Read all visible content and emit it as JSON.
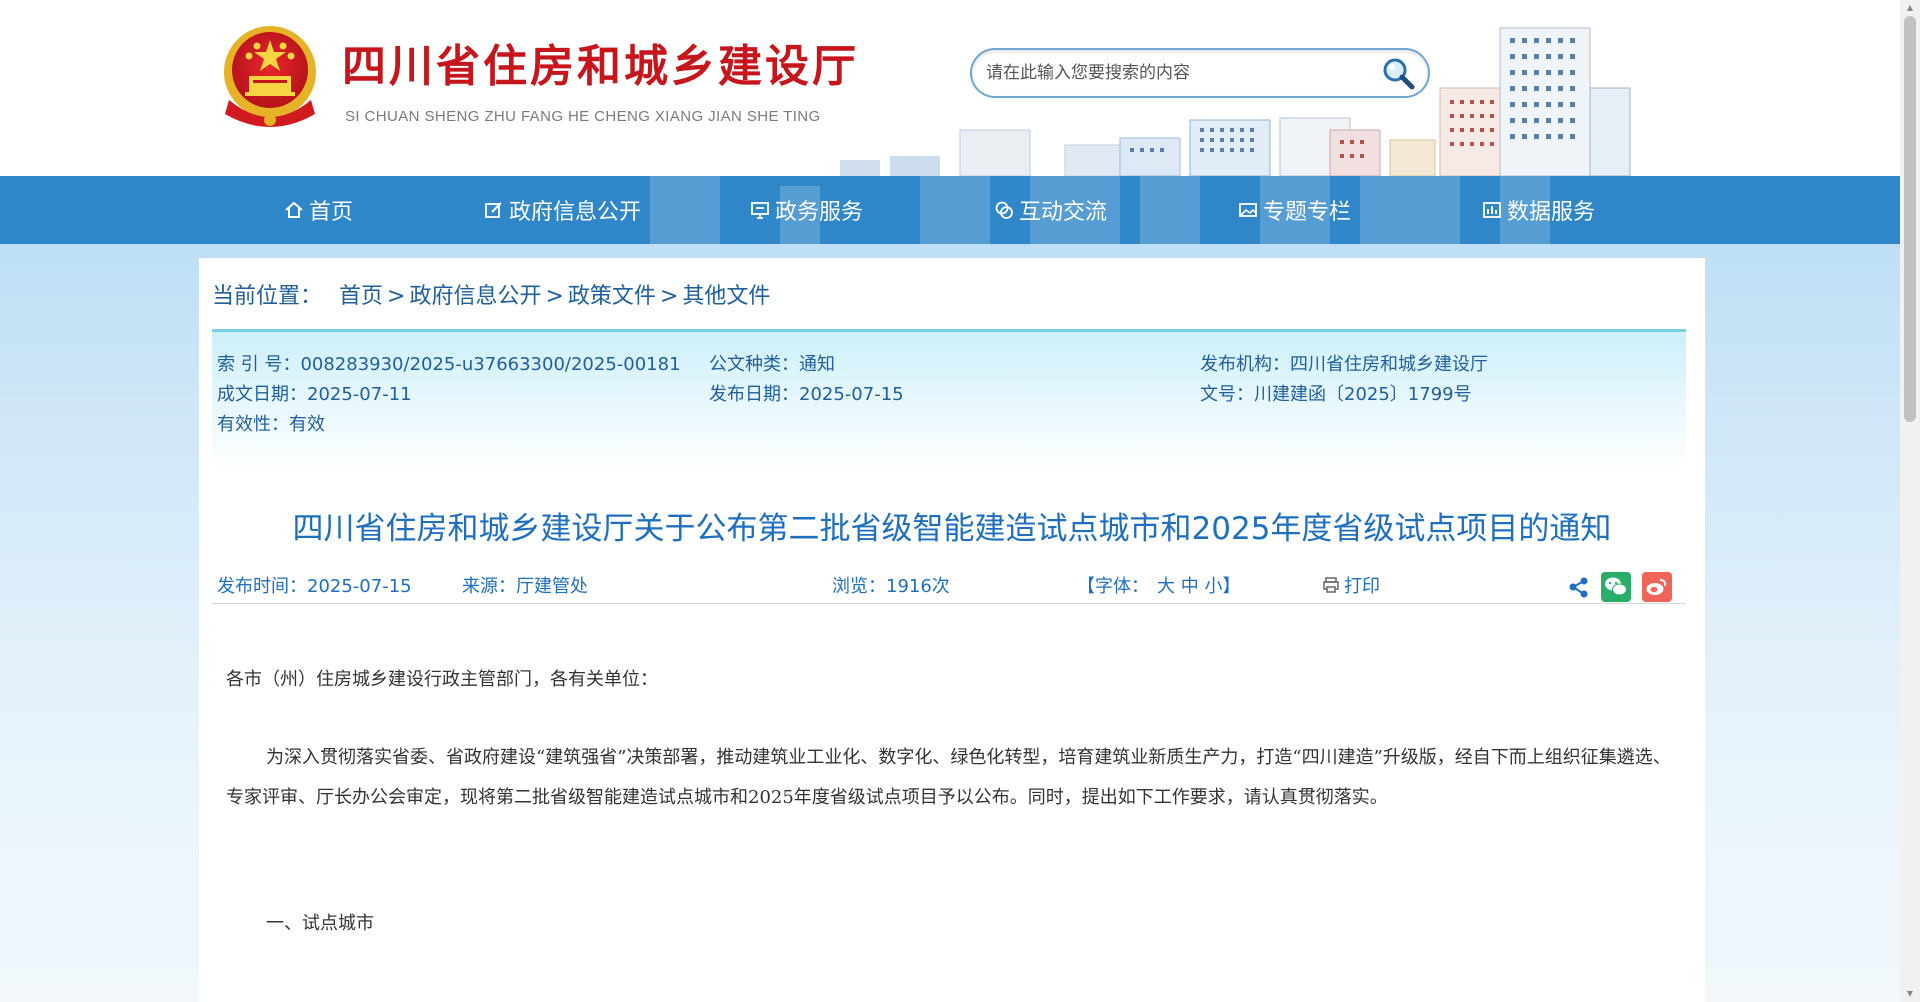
{
  "header": {
    "site_title": "四川省住房和城乡建设厅",
    "site_subtitle": "SI CHUAN SHENG ZHU FANG HE CHENG XIANG JIAN SHE TING",
    "search_placeholder": "请在此输入您要搜索的内容"
  },
  "nav": {
    "items": [
      {
        "label": "首页",
        "icon": "home-icon"
      },
      {
        "label": "政府信息公开",
        "icon": "edit-icon"
      },
      {
        "label": "政务服务",
        "icon": "monitor-icon"
      },
      {
        "label": "互动交流",
        "icon": "chat-icon"
      },
      {
        "label": "专题专栏",
        "icon": "image-icon"
      },
      {
        "label": "数据服务",
        "icon": "chart-icon"
      }
    ]
  },
  "breadcrumb": {
    "label": "当前位置：",
    "items": [
      "首页",
      "政府信息公开",
      "政策文件",
      "其他文件"
    ],
    "separator": ">"
  },
  "meta": {
    "index_no": "索 引 号：008283930/2025-u37663300/2025-00181",
    "doc_type": "公文种类：通知",
    "publisher": "发布机构：四川省住房和城乡建设厅",
    "created_date": "成文日期：2025-07-11",
    "publish_date": "发布日期：2025-07-15",
    "doc_no": "文号：川建建函〔2025〕1799号",
    "validity": "有效性：有效"
  },
  "article": {
    "title": "四川省住房和城乡建设厅关于公布第二批省级智能建造试点城市和2025年度省级试点项目的通知",
    "publish_time": "发布时间：2025-07-15",
    "source": "来源：厅建管处",
    "views": "浏览：1916次",
    "font_label_open": "【字体：",
    "font_large": "大",
    "font_medium": "中",
    "font_small": "小",
    "font_label_close": "】",
    "print_label": "打印",
    "salutation": "各市（州）住房城乡建设行政主管部门，各有关单位：",
    "paragraph1": "为深入贯彻落实省委、省政府建设“建筑强省”决策部署，推动建筑业工业化、数字化、绿色化转型，培育建筑业新质生产力，打造“四川建造”升级版，经自下而上组织征集遴选、专家评审、厅长办公会审定，现将第二批省级智能建造试点城市和2025年度省级试点项目予以公布。同时，提出如下工作要求，请认真贯彻落实。",
    "section1": "一、试点城市"
  },
  "colors": {
    "brand_red": "#c6161b",
    "nav_blue": "#2f86c8",
    "link_blue": "#1f5f9c",
    "title_blue": "#1f6fc0",
    "wechat_green": "#2aae67",
    "weibo_red": "#f0645a"
  }
}
